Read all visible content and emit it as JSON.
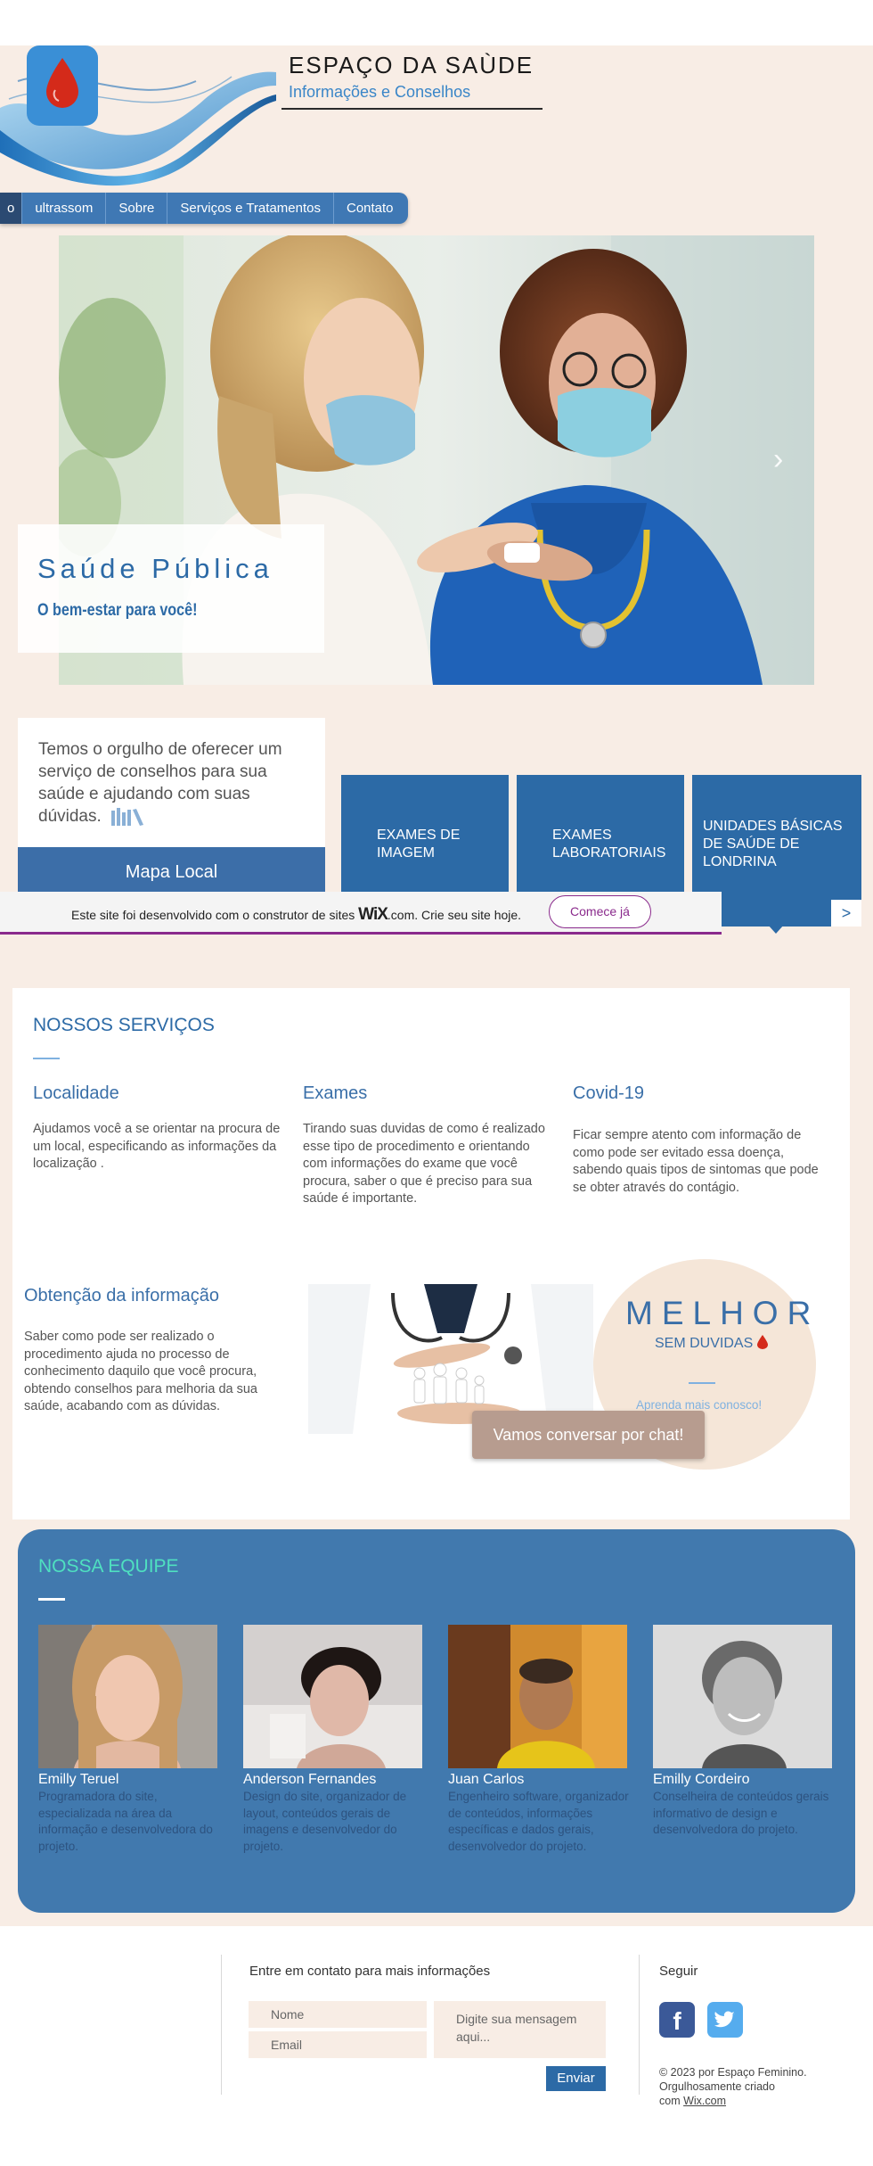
{
  "header": {
    "title": "ESPAÇO DA SAÙDE",
    "subtitle": "Informações e Conselhos"
  },
  "nav": {
    "items": [
      {
        "label": "o"
      },
      {
        "label": "ultrassom"
      },
      {
        "label": "Sobre"
      },
      {
        "label": "Serviços e Tratamentos"
      },
      {
        "label": "Contato"
      }
    ]
  },
  "hero": {
    "title": "Saúde Pública",
    "subtitle": "O bem-estar para você!",
    "next_arrow": "›"
  },
  "intro": {
    "text": "Temos o orgulho de oferecer um serviço de conselhos para sua saúde e ajudando com suas dúvidas.",
    "map_button": "Mapa Local"
  },
  "service_tiles": [
    {
      "label": "EXAMES DE IMAGEM",
      "corner": ""
    },
    {
      "label": "EXAMES LABORATORIAIS",
      "corner": ""
    },
    {
      "label": "UNIDADES BÁSICAS DE SAÚDE DE LONDRINA",
      "corner": ">"
    }
  ],
  "wix_banner": {
    "text_before": "Este site foi desenvolvido com o construtor de sites ",
    "logo": "WiX",
    "text_after": ".com. Crie seu site hoje.",
    "button": "Comece já"
  },
  "services": {
    "heading": "NOSSOS SERVIÇOS",
    "columns": [
      {
        "title": "Localidade",
        "text": "Ajudamos você a se orientar na procura de um local, especificando as informações da localização ."
      },
      {
        "title": "Exames",
        "text": "Tirando suas duvidas de como é realizado esse tipo de procedimento e orientando com informações do exame que você procura, saber o que é preciso para sua saúde é importante."
      },
      {
        "title": "Covid-19",
        "text": "Ficar sempre atento com informação de como pode ser evitado essa doença, sabendo quais tipos de sintomas que pode se obter através do contágio."
      }
    ],
    "info": {
      "title": "Obtenção da informação",
      "text": "Saber como pode ser realizado o procedimento ajuda no processo de conhecimento daquilo que você procura, obtendo conselhos para melhoria da sua saúde, acabando com as dúvidas."
    },
    "melhor": {
      "title": "MELHOR",
      "subtitle": "SEM DUVIDAS",
      "link": "Aprenda mais conosco!"
    },
    "chat_button": "Vamos conversar por chat!"
  },
  "team": {
    "heading": "NOSSA EQUIPE",
    "members": [
      {
        "name": "Emilly Teruel",
        "desc": "Programadora do site, especializada na área da informação e desenvolvedora do projeto."
      },
      {
        "name": "Anderson Fernandes",
        "desc": "Design do site, organizador de layout, conteúdos gerais de imagens e desenvolvedor do projeto."
      },
      {
        "name": "Juan Carlos",
        "desc": "Engenheiro software, organizador de conteúdos, informações específicas e dados gerais, desenvolvedor do projeto."
      },
      {
        "name": "Emilly Cordeiro",
        "desc": "Conselheira de conteúdos gerais informativo de design e desenvolvedora do projeto."
      }
    ]
  },
  "footer": {
    "contact_title": "Entre em contato para mais informações",
    "name_placeholder": "Nome",
    "email_placeholder": "Email",
    "message_placeholder": "Digite sua mensagem aqui...",
    "send_button": "Enviar",
    "follow": "Seguir",
    "facebook": "f",
    "copyright_lines": [
      "© 2023 por Espaço Feminino.",
      "Orgulhosamente criado",
      "com "
    ],
    "copyright_link": "Wix.com"
  },
  "colors": {
    "primary": "#2c6aa6",
    "team_bg": "#4179ae",
    "page_bg": "#f8ede5",
    "accent_teal": "#4fe0c0",
    "wix_purple": "#8a2a8c"
  }
}
